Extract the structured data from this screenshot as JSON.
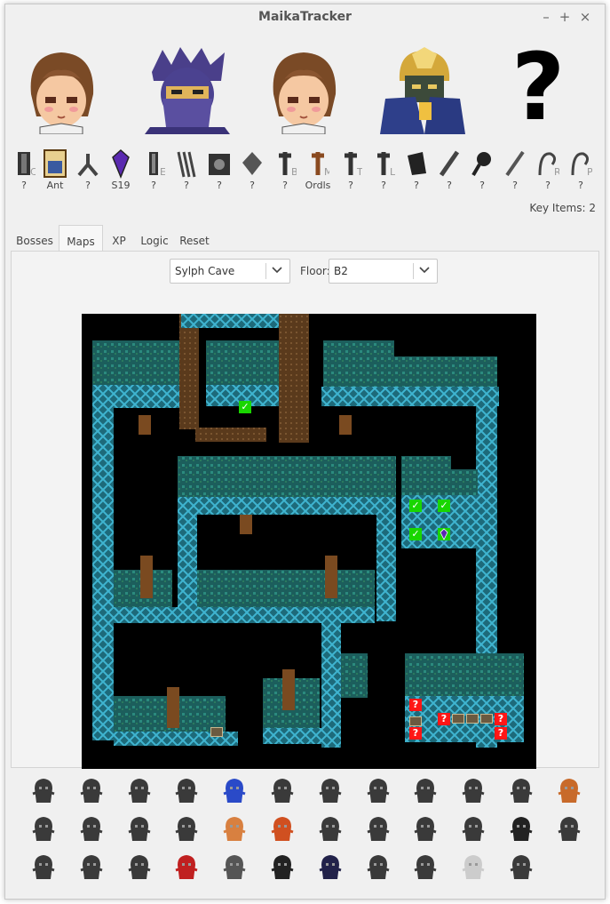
{
  "window": {
    "title": "MaikaTracker"
  },
  "window_buttons": {
    "minimize": "–",
    "maximize": "+",
    "close": "×"
  },
  "characters": [
    {
      "name": "rosa-portrait"
    },
    {
      "name": "edge-portrait"
    },
    {
      "name": "rosa-portrait"
    },
    {
      "name": "golbez-portrait"
    },
    {
      "name": "unknown-character"
    }
  ],
  "unknown_mark": "?",
  "items": [
    {
      "icon": "crystal-icon",
      "letter": "C",
      "label": "?"
    },
    {
      "icon": "pass-icon",
      "letter": "",
      "label": "Ant"
    },
    {
      "icon": "hook-icon",
      "letter": "",
      "label": "?"
    },
    {
      "icon": "darkness-crystal-icon",
      "letter": "",
      "label": "S19"
    },
    {
      "icon": "earth-crystal-icon",
      "letter": "E",
      "label": "?"
    },
    {
      "icon": "twin-harp-icon",
      "letter": "",
      "label": "?"
    },
    {
      "icon": "tower-key-icon",
      "letter": "",
      "label": "?"
    },
    {
      "icon": "luca-key-icon",
      "letter": "",
      "label": "?"
    },
    {
      "icon": "baron-key-icon",
      "letter": "B",
      "label": "?"
    },
    {
      "icon": "magma-key-icon",
      "letter": "M",
      "label": "Ordls"
    },
    {
      "icon": "tower-key-2-icon",
      "letter": "T",
      "label": "?"
    },
    {
      "icon": "luca-key-2-icon",
      "letter": "L",
      "label": "?"
    },
    {
      "icon": "rat-tail-icon",
      "letter": "",
      "label": "?"
    },
    {
      "icon": "adamant-icon",
      "letter": "",
      "label": "?"
    },
    {
      "icon": "pan-icon",
      "letter": "",
      "label": "?"
    },
    {
      "icon": "spoon-icon",
      "letter": "",
      "label": "?"
    },
    {
      "icon": "rat-key-icon",
      "letter": "R",
      "label": "?"
    },
    {
      "icon": "pink-tail-icon",
      "letter": "P",
      "label": "?"
    }
  ],
  "key_items": "Key Items: 2",
  "tabs": [
    {
      "label": "Bosses",
      "active": false
    },
    {
      "label": "Maps",
      "active": true
    },
    {
      "label": "XP",
      "active": false
    },
    {
      "label": "Logic",
      "active": false
    },
    {
      "label": "Reset",
      "active": false
    }
  ],
  "map_select": {
    "value": "Sylph Cave"
  },
  "floor": {
    "label": "Floor:",
    "value": "B2"
  },
  "map_markers": {
    "checked": "✓",
    "unknown": "?"
  },
  "colors": {
    "checked": "#19d600",
    "unknown": "#ff1616",
    "cave_wall": "#1f6b6a",
    "cave_floor": "#2aa4b4"
  },
  "bosses": [
    "dmist-boss-icon",
    "officer-boss-icon",
    "octomamm-boss-icon",
    "antlion-boss-icon",
    "waterhag-boss-icon",
    "mombomb-boss-icon",
    "fabul-gauntlet-boss-icon",
    "milon-boss-icon",
    "milon-z-boss-icon",
    "dark-kain-boss-icon",
    "karate-boss-icon",
    "baigan-boss-icon",
    "kainazzo-boss-icon",
    "dark-elf-boss-icon",
    "magus-sisters-boss-icon",
    "valvalis-boss-icon",
    "calbrena-boss-icon",
    "golbez-boss-icon",
    "lugae-boss-icon",
    "dark-imps-boss-icon",
    "king-queen-boss-icon",
    "rubicant-boss-icon",
    "evilwall-boss-icon",
    "asura-boss-icon",
    "leviathan-boss-icon",
    "odin-boss-icon",
    "bahamut-boss-icon",
    "elements-boss-icon",
    "cpu-boss-icon",
    "pale-dim-boss-icon",
    "wyvern-boss-icon",
    "plague-boss-icon",
    "dlunars-boss-icon",
    "ogopogo-boss-icon",
    "zeromus-boss-icon"
  ]
}
